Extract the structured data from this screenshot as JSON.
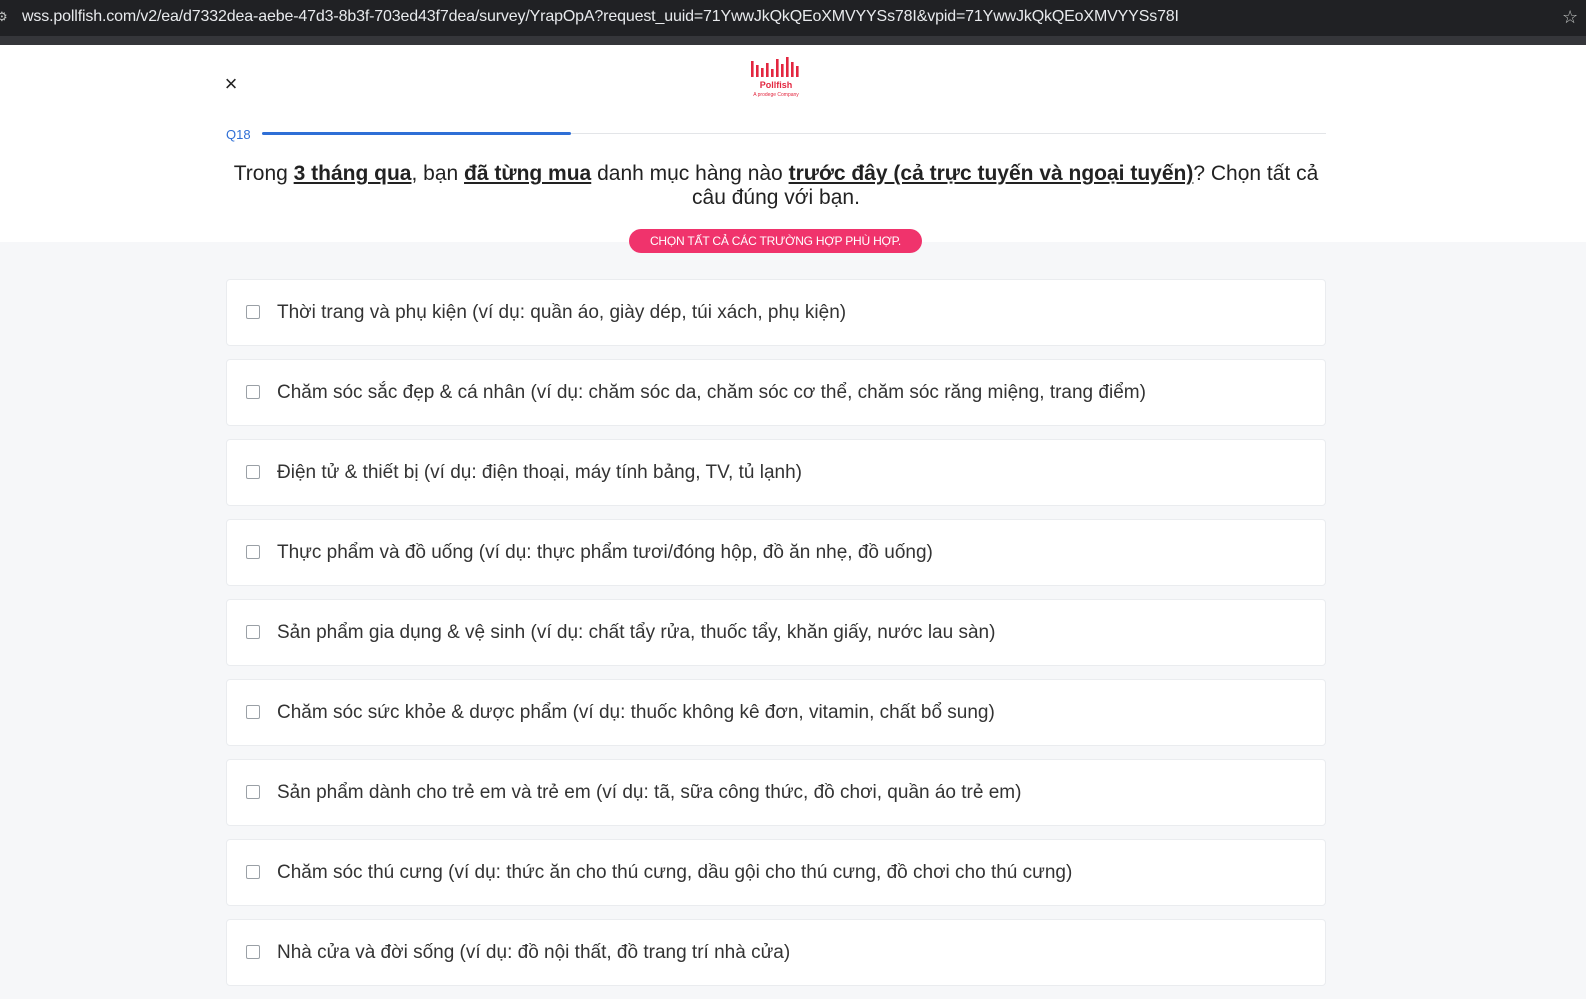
{
  "browser": {
    "url": "wss.pollfish.com/v2/ea/d7332dea-aebe-47d3-8b3f-703ed43f7dea/survey/YrapOpA?request_uuid=71YwwJkQkQEoXMVYYSs78I&vpid=71YwwJkQkQEoXMVYYSs78I",
    "site_icon": "tune-icon",
    "star_icon": "star-icon"
  },
  "header": {
    "close_label": "×",
    "logo_brand": "Pollfish",
    "logo_sub": "A prodege Company",
    "question_number": "Q18",
    "progress_fraction": 0.29,
    "question_parts": [
      {
        "text": "Trong ",
        "bold": false
      },
      {
        "text": "3 tháng qua",
        "bold": true
      },
      {
        "text": ", bạn ",
        "bold": false
      },
      {
        "text": "đã từng mua",
        "bold": true
      },
      {
        "text": " danh mục hàng nào ",
        "bold": false
      },
      {
        "text": "trước đây (cả trực tuyến và ngoại tuyến)",
        "bold": true
      },
      {
        "text": "? Chọn tất cả câu đúng với bạn.",
        "bold": false
      }
    ],
    "instruction": "CHỌN TẤT CẢ CÁC TRƯỜNG HỢP PHÙ HỢP.",
    "accent_color": "#f0336c",
    "progress_color": "#2f6fd6"
  },
  "options": [
    {
      "label": "Thời trang và phụ kiện (ví dụ: quần áo, giày dép, túi xách, phụ kiện)",
      "checked": false
    },
    {
      "label": "Chăm sóc sắc đẹp & cá nhân (ví dụ: chăm sóc da, chăm sóc cơ thể, chăm sóc răng miệng, trang điểm)",
      "checked": false
    },
    {
      "label": "Điện tử & thiết bị (ví dụ: điện thoại, máy tính bảng, TV, tủ lạnh)",
      "checked": false
    },
    {
      "label": "Thực phẩm và đồ uống (ví dụ: thực phẩm tươi/đóng hộp, đồ ăn nhẹ, đồ uống)",
      "checked": false
    },
    {
      "label": "Sản phẩm gia dụng & vệ sinh (ví dụ: chất tẩy rửa, thuốc tẩy, khăn giấy, nước lau sàn)",
      "checked": false
    },
    {
      "label": "Chăm sóc sức khỏe & dược phẩm (ví dụ: thuốc không kê đơn, vitamin, chất bổ sung)",
      "checked": false
    },
    {
      "label": "Sản phẩm dành cho trẻ em và trẻ em (ví dụ: tã, sữa công thức, đồ chơi, quần áo trẻ em)",
      "checked": false
    },
    {
      "label": "Chăm sóc thú cưng (ví dụ: thức ăn cho thú cưng, dầu gội cho thú cưng, đồ chơi cho thú cưng)",
      "checked": false
    },
    {
      "label": "Nhà cửa và đời sống (ví dụ: đồ nội thất, đồ trang trí nhà cửa)",
      "checked": false
    }
  ]
}
